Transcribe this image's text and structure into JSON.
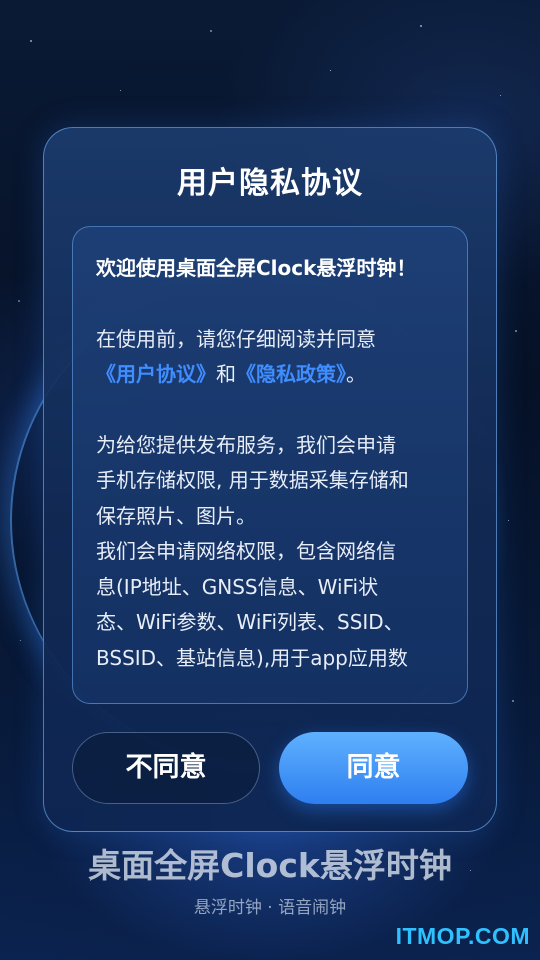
{
  "dialog": {
    "title": "用户隐私协议",
    "welcome": "欢迎使用桌面全屏Clock悬浮时钟！",
    "intro_prefix": "在使用前，请您仔细阅读并同意",
    "user_agreement_link": "《用户协议》",
    "and_text": "和",
    "privacy_policy_link": "《隐私政策》",
    "intro_suffix": "。",
    "body_lines": [
      "为给您提供发布服务，我们会申请",
      "手机存储权限, 用于数据采集存储和",
      "保存照片、图片。",
      "我们会申请网络权限，包含网络信",
      "息(IP地址、GNSS信息、WiFi状",
      "态、WiFi参数、WiFi列表、SSID、",
      "BSSID、基站信息),用于app应用数"
    ],
    "disagree_label": "不同意",
    "agree_label": "同意"
  },
  "app": {
    "name": "桌面全屏Clock悬浮时钟",
    "tagline": "悬浮时钟 · 语音闹钟"
  },
  "watermark": "ITMOP.COM",
  "colors": {
    "link": "#3f8dff",
    "agree_button": "#3a8cf5",
    "watermark": "#2fc1ff"
  }
}
